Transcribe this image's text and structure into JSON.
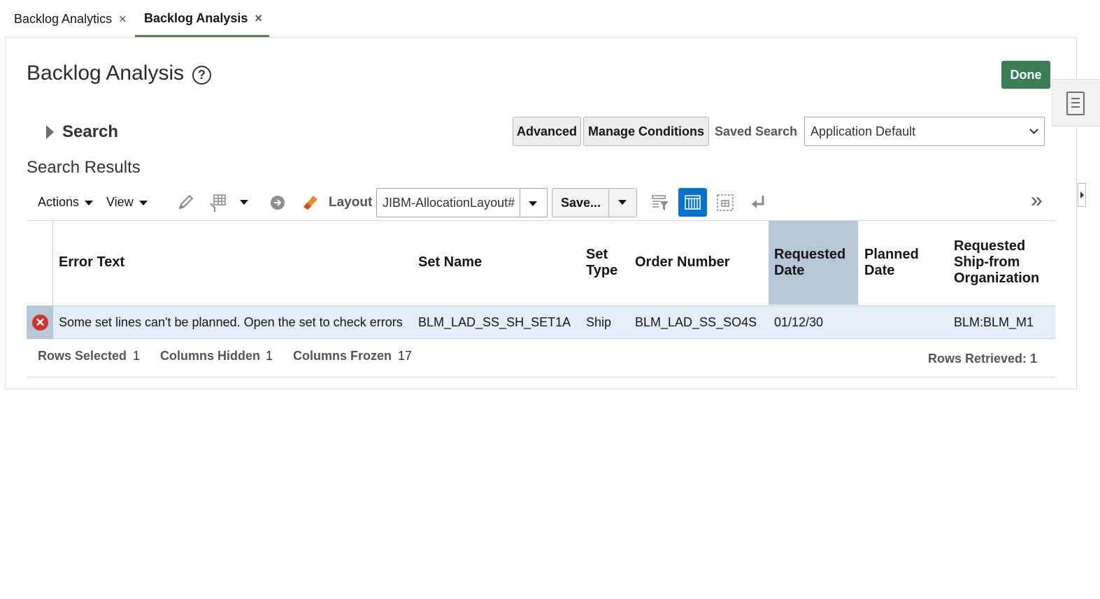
{
  "tabs": [
    {
      "label": "Backlog Analytics",
      "close": "×"
    },
    {
      "label": "Backlog Analysis",
      "close": "×"
    }
  ],
  "page": {
    "title": "Backlog Analysis",
    "help_glyph": "?",
    "done_label": "Done"
  },
  "search": {
    "label": "Search",
    "advanced_label": "Advanced",
    "manage_conditions_label": "Manage Conditions",
    "saved_search_label": "Saved Search",
    "saved_search_value": "Application Default"
  },
  "results": {
    "title": "Search Results",
    "toolbar": {
      "actions_label": "Actions",
      "view_label": "View",
      "layout_label": "Layout",
      "layout_value": "JIBM-AllocationLayout#",
      "save_label": "Save...",
      "overflow_glyph": "»"
    },
    "columns": [
      {
        "line1": "Error Text",
        "line2": "",
        "line3": ""
      },
      {
        "line1": "Set Name",
        "line2": "",
        "line3": ""
      },
      {
        "line1": "Set",
        "line2": "Type",
        "line3": ""
      },
      {
        "line1": "Order Number",
        "line2": "",
        "line3": ""
      },
      {
        "line1": "Requested",
        "line2": "Date",
        "line3": ""
      },
      {
        "line1": "Planned",
        "line2": "Date",
        "line3": ""
      },
      {
        "line1": "Requested",
        "line2": "Ship-from",
        "line3": "Organization"
      }
    ],
    "rows": [
      {
        "status_glyph": "✕",
        "error_text": "Some set lines can't be planned. Open the set to check errors",
        "set_name": "BLM_LAD_SS_SH_SET1A",
        "set_type": "Ship",
        "order_number": "BLM_LAD_SS_SO4S",
        "requested_date": "01/12/30",
        "planned_date": "",
        "ship_from_org": "BLM:BLM_M1"
      }
    ],
    "status": {
      "rows_selected_label": "Rows Selected",
      "rows_selected_value": "1",
      "columns_hidden_label": "Columns Hidden",
      "columns_hidden_value": "1",
      "columns_frozen_label": "Columns Frozen",
      "columns_frozen_value": "17",
      "rows_retrieved_label": "Rows Retrieved: 1"
    }
  },
  "colors": {
    "accent_green": "#3b7d54",
    "tab_underline": "#5f7d4f",
    "selection": "#e3eef8",
    "header_highlight": "#b6c8d8",
    "active_icon": "#0572ce",
    "error": "#d6312e"
  },
  "icons": [
    "help-icon",
    "close-icon",
    "chevron-down-icon",
    "edit-icon",
    "freeze-column-icon",
    "go-to-icon",
    "clear-icon",
    "query-by-example-icon",
    "column-view-icon",
    "detach-icon",
    "wrap-icon",
    "overflow-icon",
    "error-icon",
    "document-icon"
  ]
}
